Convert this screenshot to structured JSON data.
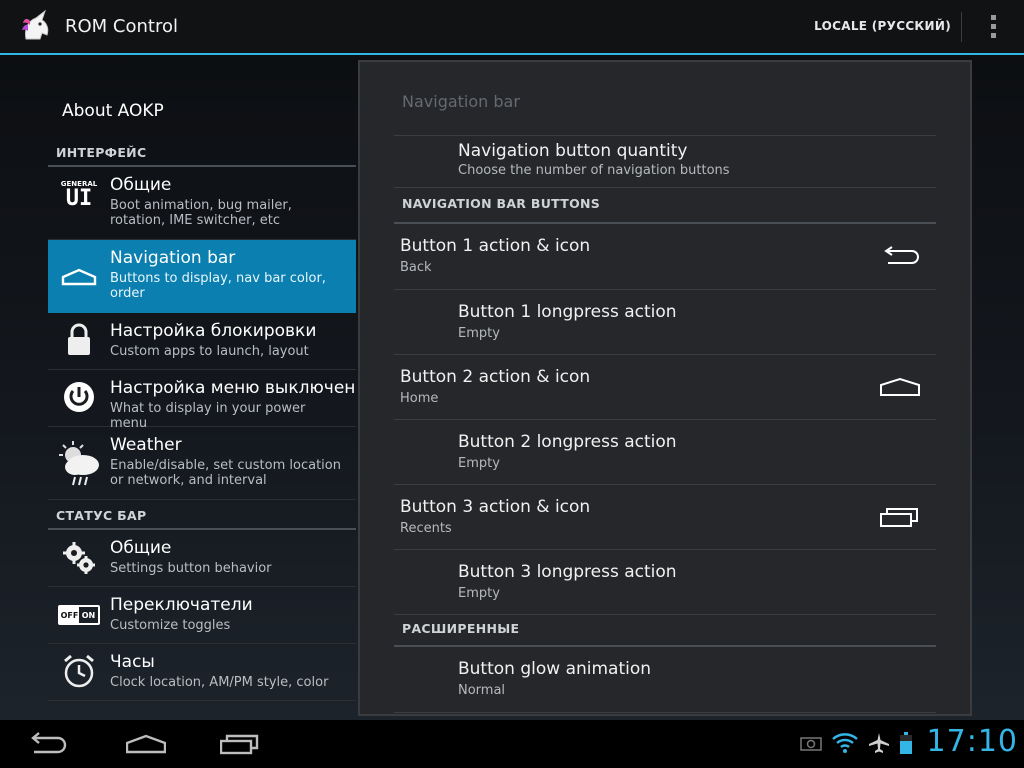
{
  "app": {
    "title": "ROM Control",
    "locale_button": "LOCALE (РУССКИЙ)"
  },
  "left": {
    "about": "About AOKP",
    "sections": [
      {
        "header": "ИНТЕРФЕЙС"
      },
      {
        "header": "СТАТУС БАР"
      }
    ],
    "items": [
      {
        "title": "Общие",
        "summary": "Boot animation, bug mailer, rotation, IME switcher, etc",
        "icon": "general-ui-icon"
      },
      {
        "title": "Navigation bar",
        "summary": "Buttons to display, nav bar color, order",
        "icon": "home-outline-icon"
      },
      {
        "title": "Настройка блокировки",
        "summary": "Custom apps to launch, layout",
        "icon": "lock-icon"
      },
      {
        "title": "Настройка меню выключения",
        "summary": "What to display in your power menu",
        "icon": "power-icon"
      },
      {
        "title": "Weather",
        "summary": "Enable/disable, set custom location or network, and interval",
        "icon": "weather-icon"
      },
      {
        "title": "Общие",
        "summary": "Settings button behavior",
        "icon": "gears-icon"
      },
      {
        "title": "Переключатели",
        "summary": "Customize toggles",
        "icon": "toggle-off-on-icon"
      },
      {
        "title": "Часы",
        "summary": "Clock location, AM/PM style, color",
        "icon": "alarm-clock-icon"
      }
    ],
    "toggle_icon_off": "OFF",
    "toggle_icon_on": "ON",
    "general_icon_small": "GENERAL",
    "general_icon_big": "UI"
  },
  "panel": {
    "title": "Navigation bar",
    "quantity": {
      "title": "Navigation button quantity",
      "summary": "Choose the number of navigation buttons"
    },
    "buttons_header": "NAVIGATION BAR BUTTONS",
    "items": [
      {
        "title": "Button 1 action & icon",
        "summary": "Back",
        "icon": "back-icon"
      },
      {
        "title": "Button 1 longpress action",
        "summary": "Empty"
      },
      {
        "title": "Button 2 action & icon",
        "summary": "Home",
        "icon": "home-icon"
      },
      {
        "title": "Button 2 longpress action",
        "summary": "Empty"
      },
      {
        "title": "Button 3 action & icon",
        "summary": "Recents",
        "icon": "recents-icon"
      },
      {
        "title": "Button 3 longpress action",
        "summary": "Empty"
      }
    ],
    "advanced_header": "РАСШИРЕННЫЕ",
    "glow": {
      "title": "Button glow animation",
      "summary": "Normal"
    }
  },
  "statusbar": {
    "time": "17:10"
  },
  "colors": {
    "accent": "#33b5e5",
    "selected": "#0a7fb0"
  }
}
